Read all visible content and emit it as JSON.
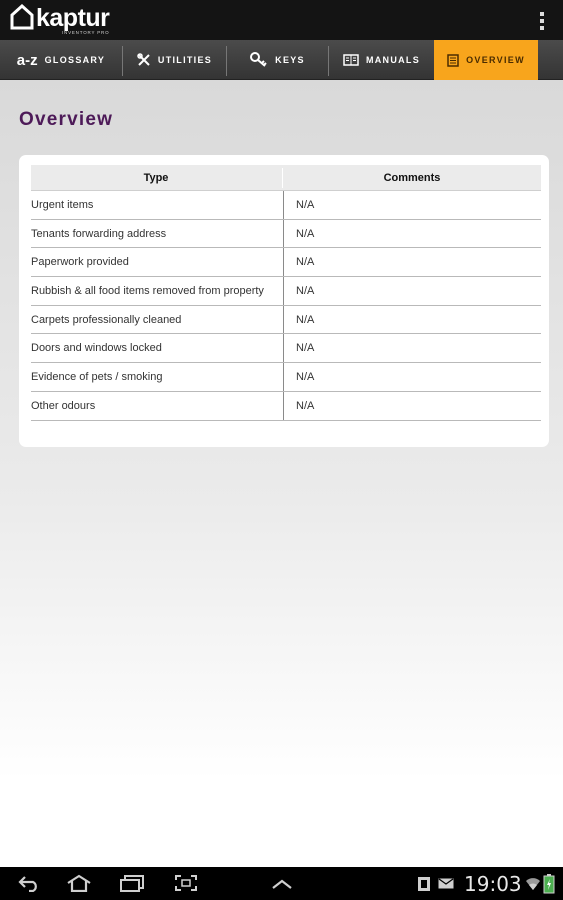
{
  "app": {
    "logo_text": "kaptur",
    "logo_subtext": "INVENTORY PRO"
  },
  "tabs": [
    {
      "label": "GLOSSARY",
      "icon": "a-z-icon",
      "glyph": "a-z",
      "active": false
    },
    {
      "label": "UTILITIES",
      "icon": "tools-icon",
      "active": false
    },
    {
      "label": "KEYS",
      "icon": "key-icon",
      "active": false
    },
    {
      "label": "MANUALS",
      "icon": "book-icon",
      "active": false
    },
    {
      "label": "OVERVIEW",
      "icon": "document-icon",
      "active": true
    }
  ],
  "page": {
    "title": "Overview"
  },
  "table": {
    "columns": [
      "Type",
      "Comments"
    ],
    "rows": [
      {
        "type": "Urgent items",
        "comment": "N/A"
      },
      {
        "type": "Tenants forwarding address",
        "comment": "N/A"
      },
      {
        "type": "Paperwork provided",
        "comment": "N/A"
      },
      {
        "type": "Rubbish & all food items removed from property",
        "comment": "N/A"
      },
      {
        "type": "Carpets professionally cleaned",
        "comment": "N/A"
      },
      {
        "type": "Doors and windows locked",
        "comment": "N/A"
      },
      {
        "type": "Evidence of pets / smoking",
        "comment": "N/A"
      },
      {
        "type": "Other odours",
        "comment": "N/A"
      }
    ]
  },
  "system_bar": {
    "time": "19:03",
    "icons": [
      "back-icon",
      "home-icon",
      "recent-apps-icon",
      "screenshot-icon",
      "up-chevron-icon",
      "notification-icon",
      "email-icon",
      "wifi-icon",
      "battery-icon"
    ]
  },
  "colors": {
    "accent": "#f8a51c",
    "title": "#4d1a58",
    "appbar": "#141414",
    "tabbar": "#3d3d3d"
  }
}
